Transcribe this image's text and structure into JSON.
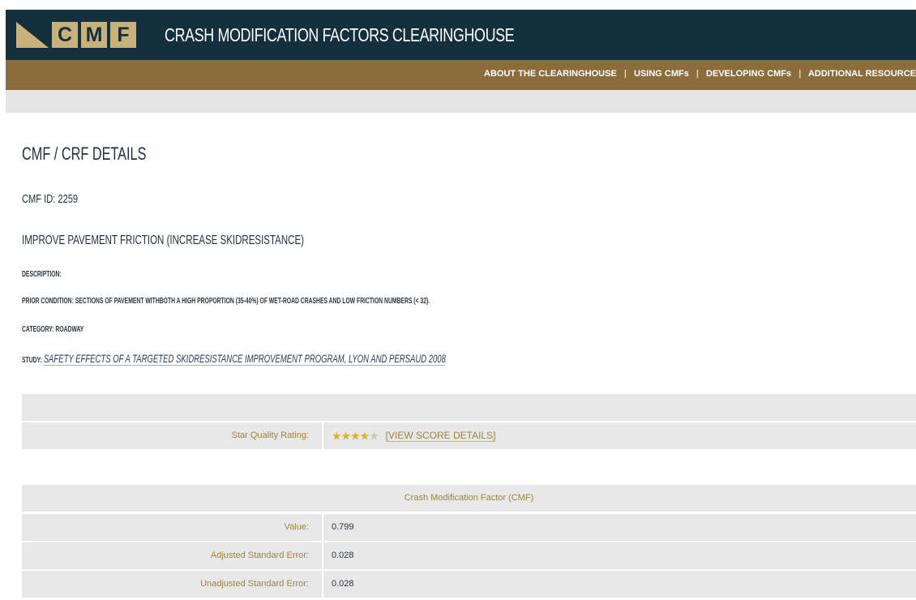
{
  "header": {
    "logo_letters": [
      "C",
      "M",
      "F"
    ],
    "site_title": "CRASH MODIFICATION FACTORS CLEARINGHOUSE",
    "bg_color": "#14303f",
    "logo_color": "#c8b27a"
  },
  "nav": {
    "items": [
      "ABOUT THE CLEARINGHOUSE",
      "USING CMFs",
      "DEVELOPING CMFs",
      "ADDITIONAL RESOURCE"
    ],
    "separator": "|",
    "bg_color": "#8a6d3b"
  },
  "page": {
    "heading": "CMF / CRF DETAILS",
    "cmf_id": "CMF ID: 2259",
    "countermeasure": "IMPROVE PAVEMENT FRICTION (INCREASE SKIDRESISTANCE)",
    "description_label": "DESCRIPTION:",
    "prior_condition": "PRIOR CONDITION: SECTIONS OF PAVEMENT WITHBOTH A HIGH PROPORTION (35-40%) OF WET-ROAD CRASHES AND LOW FRICTION NUMBERS (< 32).",
    "category": "CATEGORY: ROADWAY",
    "study_label": "STUDY:",
    "study_link": "SAFETY EFFECTS OF A TARGETED SKIDRESISTANCE IMPROVEMENT PROGRAM, LYON AND PERSAUD 2008"
  },
  "rating": {
    "label": "Star Quality Rating:",
    "stars_filled": 4,
    "stars_total": 5,
    "details_link": "[VIEW SCORE DETAILS]"
  },
  "cmf_table": {
    "header": "Crash Modification Factor (CMF)",
    "rows": [
      {
        "label": "Value:",
        "value": "0.799"
      },
      {
        "label": "Adjusted Standard Error:",
        "value": "0.028"
      },
      {
        "label": "Unadjusted Standard Error:",
        "value": "0.028"
      }
    ]
  }
}
